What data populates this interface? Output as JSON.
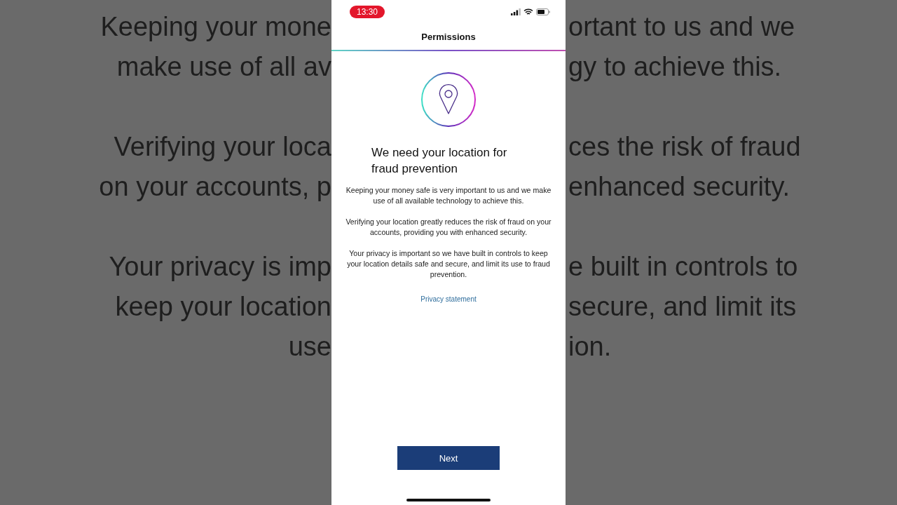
{
  "backdrop": {
    "paragraphs": [
      {
        "left": [
          "Keeping your mone",
          "make use of all av"
        ],
        "right": [
          "ortant to us and we",
          "gy to achieve this."
        ]
      },
      {
        "left": [
          "Verifying your loca",
          "on your accounts, p"
        ],
        "right": [
          "ces the risk of fraud",
          "enhanced security."
        ]
      },
      {
        "left": [
          "Your privacy is imp",
          "keep your location",
          "use"
        ],
        "right": [
          "e built in controls to",
          "secure, and limit its",
          "ion."
        ]
      }
    ]
  },
  "status_bar": {
    "time": "13:30"
  },
  "header": {
    "title": "Permissions"
  },
  "heading": "We need your location for fraud prevention",
  "paragraphs": [
    "Keeping your money safe is very important to us and we make use of all available technology to achieve this.",
    "Verifying your location greatly reduces the risk of fraud on your accounts, providing you with enhanced security.",
    "Your privacy is important so we have built in controls to keep your location details safe and secure, and limit its use to fraud prevention."
  ],
  "link": "Privacy statement",
  "button": "Next"
}
